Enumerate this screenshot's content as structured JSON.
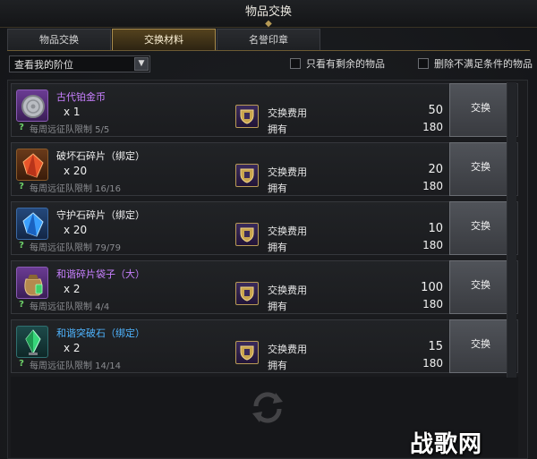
{
  "window": {
    "title": "物品交换"
  },
  "tabs": [
    {
      "label": "物品交换",
      "active": false
    },
    {
      "label": "交换材料",
      "active": true
    },
    {
      "label": "名誉印章",
      "active": false
    }
  ],
  "filters": {
    "tier_select": "查看我的阶位",
    "only_remaining": "只看有剩余的物品",
    "hide_unmet": "删除不满足条件的物品"
  },
  "items": [
    {
      "name": "古代铂金币",
      "name_color": "#c880ff",
      "qty": "x 1",
      "limit": "每周远征队限制 5/5",
      "cost_label": "交换费用",
      "cost": "50",
      "own_label": "拥有",
      "own": "180",
      "button": "交换",
      "icon": "silver-coin-icon"
    },
    {
      "name": "破坏石碎片（绑定）",
      "name_color": "#f0f0f0",
      "qty": "x 20",
      "limit": "每周远征队限制 16/16",
      "cost_label": "交换费用",
      "cost": "20",
      "own_label": "拥有",
      "own": "180",
      "button": "交换",
      "icon": "red-crystal-icon"
    },
    {
      "name": "守护石碎片（绑定）",
      "name_color": "#f0f0f0",
      "qty": "x 20",
      "limit": "每周远征队限制 79/79",
      "cost_label": "交换费用",
      "cost": "10",
      "own_label": "拥有",
      "own": "180",
      "button": "交换",
      "icon": "blue-crystal-icon"
    },
    {
      "name": "和谐碎片袋子（大）",
      "name_color": "#c880ff",
      "qty": "x 2",
      "limit": "每周远征队限制 4/4",
      "cost_label": "交换费用",
      "cost": "100",
      "own_label": "拥有",
      "own": "180",
      "button": "交换",
      "icon": "pouch-icon"
    },
    {
      "name": "和谐突破石（绑定）",
      "name_color": "#4fb4ff",
      "qty": "x 2",
      "limit": "每周远征队限制 14/14",
      "cost_label": "交换费用",
      "cost": "15",
      "own_label": "拥有",
      "own": "180",
      "button": "交换",
      "icon": "green-gem-icon"
    }
  ],
  "watermark": "战歌网"
}
